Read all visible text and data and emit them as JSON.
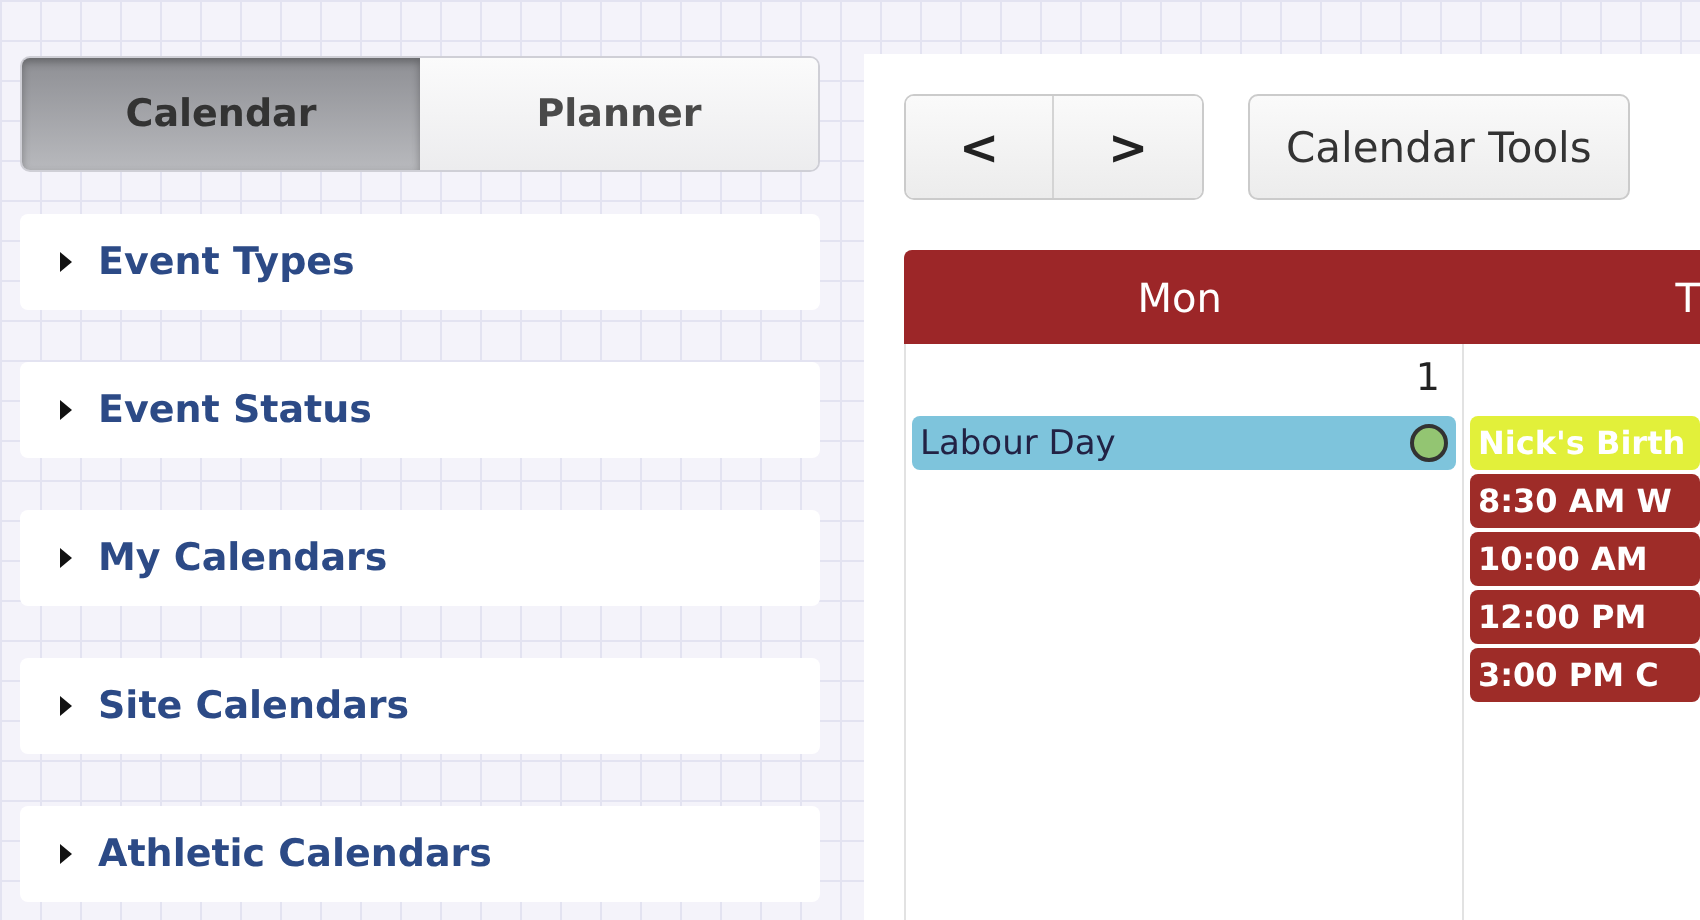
{
  "tabs": [
    {
      "label": "Calendar",
      "selected": true
    },
    {
      "label": "Planner",
      "selected": false
    }
  ],
  "filters": [
    {
      "label": "Event Types",
      "expanded": false
    },
    {
      "label": "Event Status",
      "expanded": false
    },
    {
      "label": "My Calendars",
      "expanded": false
    },
    {
      "label": "Site Calendars",
      "expanded": false
    },
    {
      "label": "Athletic Calendars",
      "expanded": false
    }
  ],
  "nav": {
    "prev": "<",
    "next": ">",
    "tools": "Calendar Tools"
  },
  "columns": [
    {
      "heading": "Mon",
      "date": "1",
      "events": [
        {
          "label": "Labour Day",
          "color": "#7ec4dc",
          "indicator": true
        }
      ]
    },
    {
      "heading": "T",
      "events": [
        {
          "label": "Nick's Birth",
          "color": "#e2f03a",
          "indicator": false
        },
        {
          "label": "8:30 AM W",
          "color": "#9e2c28",
          "indicator": false
        },
        {
          "label": "10:00 AM",
          "color": "#9e2c28",
          "indicator": false
        },
        {
          "label": "12:00 PM",
          "color": "#9e2c28",
          "indicator": false
        },
        {
          "label": "3:00 PM C",
          "color": "#9e2c28",
          "indicator": false
        }
      ]
    }
  ]
}
